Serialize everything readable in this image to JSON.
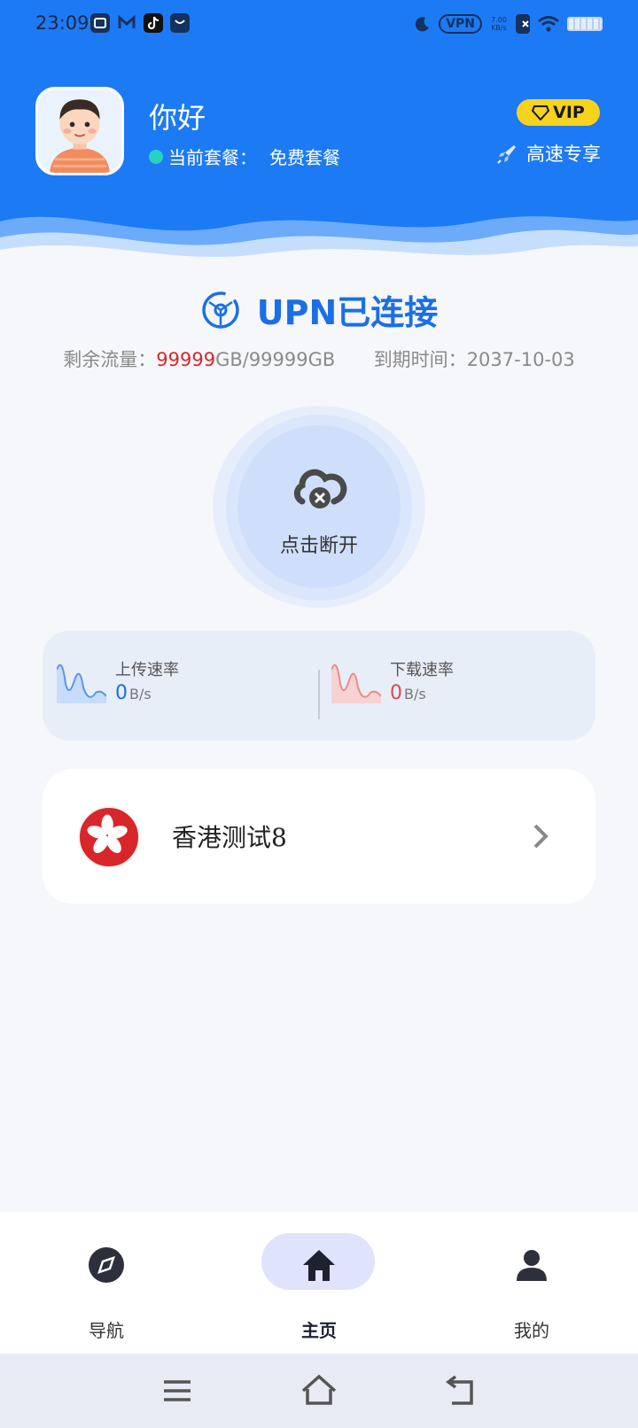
{
  "status_bar": {
    "time": "23:09",
    "vpn_badge": "VPN",
    "net_speed_value": "7.00",
    "net_speed_unit": "KB/s"
  },
  "header": {
    "greeting": "你好",
    "plan_label": "当前套餐：",
    "plan_value": "免费套餐",
    "vip_badge": "VIP",
    "fast_label": "高速专享"
  },
  "connection": {
    "title": "UPN已连接",
    "traffic_label": "剩余流量：",
    "traffic_used": "99999",
    "traffic_total": "GB/99999GB",
    "expire_label": "到期时间：",
    "expire_value": "2037-10-03",
    "disconnect_label": "点击断开"
  },
  "speed": {
    "upload_label": "上传速率",
    "upload_value": "0",
    "upload_unit": "B/s",
    "download_label": "下载速率",
    "download_value": "0",
    "download_unit": "B/s"
  },
  "server": {
    "name": "香港测试8"
  },
  "bottom_nav": {
    "items": [
      {
        "label": "导航",
        "icon": "compass-icon"
      },
      {
        "label": "主页",
        "icon": "home-icon",
        "active": true
      },
      {
        "label": "我的",
        "icon": "user-icon"
      }
    ]
  },
  "system_nav": {
    "icons": [
      "menu-icon",
      "home-outline-icon",
      "back-icon"
    ]
  },
  "colors": {
    "primary": "#1d7af5",
    "accent_red": "#d8262b",
    "vip_yellow": "#f7d21e"
  }
}
